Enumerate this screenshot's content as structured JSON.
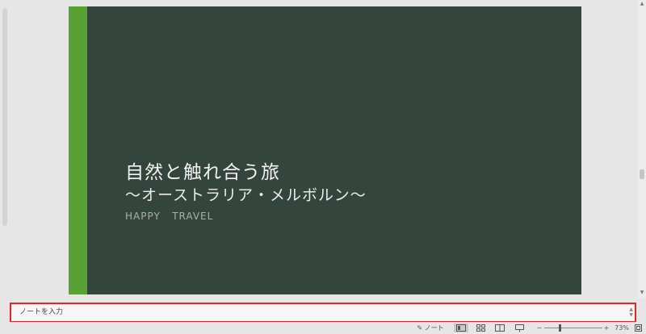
{
  "slide": {
    "title": "自然と触れ合う旅",
    "subtitle": "〜オーストラリア・メルボルン〜",
    "tagline": "HAPPY   TRAVEL",
    "colors": {
      "background": "#34453d",
      "accent": "#58a133"
    }
  },
  "notes": {
    "placeholder": "ノートを入力",
    "highlight_color": "#e52424"
  },
  "statusbar": {
    "notes_label": "ノート",
    "zoom_minus": "−",
    "zoom_plus": "+",
    "zoom_level": "73%",
    "zoom_fraction": 0.26,
    "active_view": "normal",
    "icons": [
      "notes-icon",
      "normal-view-icon",
      "slide-sorter-icon",
      "reading-view-icon",
      "slideshow-icon",
      "fit-to-window-icon"
    ]
  }
}
